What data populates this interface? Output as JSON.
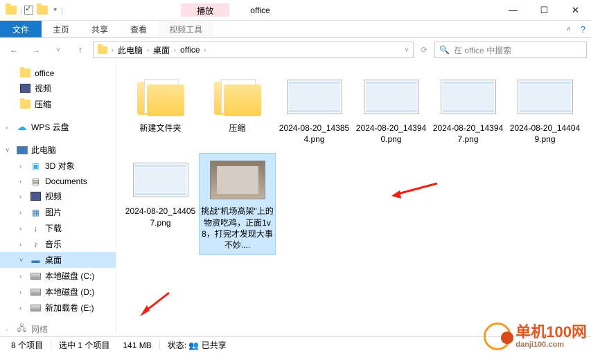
{
  "titlebar": {
    "play_tab": "播放",
    "title": "office"
  },
  "window_controls": {
    "min": "—",
    "max": "☐",
    "close": "✕"
  },
  "ribbon": {
    "file": "文件",
    "tabs": [
      "主页",
      "共享",
      "查看"
    ],
    "tool_tab": "视频工具"
  },
  "breadcrumb": {
    "segments": [
      "此电脑",
      "桌面",
      "office"
    ]
  },
  "search": {
    "placeholder": "在 office 中搜索"
  },
  "nav": {
    "office": "office",
    "video": "视频",
    "zip": "压缩",
    "wps": "WPS 云盘",
    "this_pc": "此电脑",
    "obj3d": "3D 对象",
    "docs": "Documents",
    "video2": "视频",
    "pics": "图片",
    "dl": "下载",
    "music": "音乐",
    "desktop": "桌面",
    "diskC": "本地磁盘 (C:)",
    "diskD": "本地磁盘 (D:)",
    "diskE": "新加载卷 (E:)",
    "net": "网络"
  },
  "items": [
    {
      "name": "新建文件夹"
    },
    {
      "name": "压缩"
    },
    {
      "name": "2024-08-20_143854.png"
    },
    {
      "name": "2024-08-20_143940.png"
    },
    {
      "name": "2024-08-20_143947.png"
    },
    {
      "name": "2024-08-20_144049.png"
    },
    {
      "name": "2024-08-20_144057.png"
    },
    {
      "name": "挑战\"机场高架\"上的物资吃鸡，正面1v8，打完才发现大事不妙...."
    }
  ],
  "status": {
    "count": "8 个项目",
    "selected": "选中 1 个项目",
    "size": "141 MB",
    "state_label": "状态:",
    "state_value": "已共享"
  },
  "watermark": {
    "main": "单机100网",
    "sub": "danji100.com"
  }
}
